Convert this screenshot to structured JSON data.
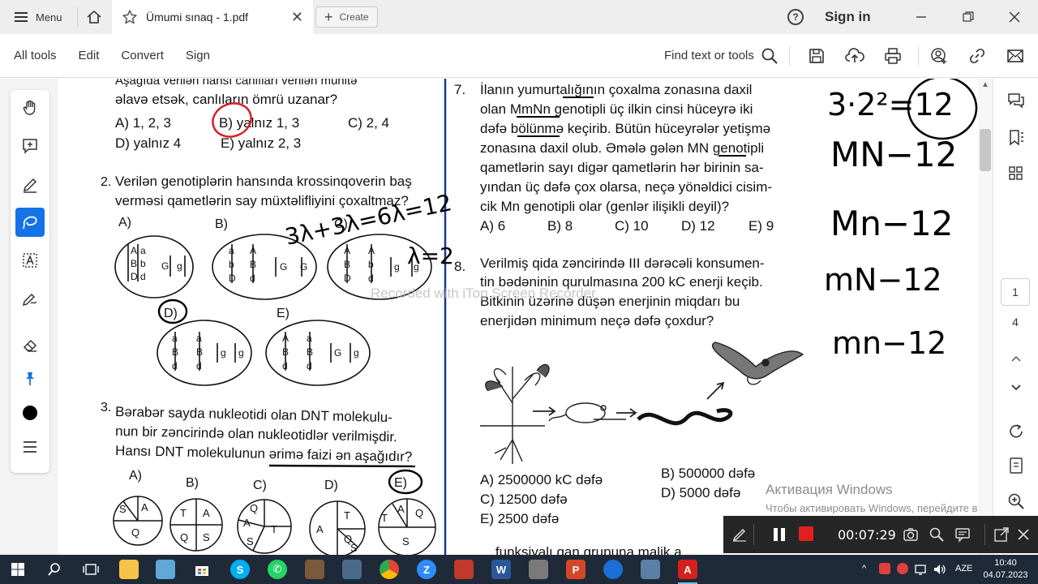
{
  "titlebar": {
    "menu_label": "Menu",
    "tab_title": "Ümumi sınaq - 1.pdf",
    "tab_close": "✕",
    "create_label": "Create",
    "help_symbol": "?",
    "signin_label": "Sign in"
  },
  "toolbar": {
    "items": [
      "All tools",
      "Edit",
      "Convert",
      "Sign"
    ],
    "find_label": "Find text or tools"
  },
  "page_nav": {
    "current": "1",
    "total": "4"
  },
  "watermark": "Recorded with iTop Screen Recorder",
  "activation": {
    "title": "Активация Windows",
    "text": "Чтобы активировать Windows, перейдите в раздел \"Параметры\"."
  },
  "recorder": {
    "time": "00:07:29"
  },
  "taskbar": {
    "lang": "AZE",
    "time": "10:40",
    "date": "04.07.2023",
    "running_apps": [
      "adobe-acrobat"
    ]
  },
  "document": {
    "q1": {
      "stem": [
        "Aşağıda verilən hansı canlıları verilən mühitə",
        "əlavə etsək, canlıların ömrü uzanar?"
      ],
      "options": [
        "A) 1, 2, 3",
        "B) yalnız 1, 3",
        "C) 2, 4",
        "D) yalnız 4",
        "E) yalnız 2, 3"
      ]
    },
    "q2": {
      "number": "2.",
      "stem": [
        "Verilən genotiplərin hansında krossinqoverin baş",
        "verməsi qametlərin say müxtəlifliyini çoxaltmaz?"
      ],
      "options": [
        "A)",
        "B)",
        "C)",
        "D)",
        "E)"
      ]
    },
    "q3": {
      "number": "3.",
      "stem": [
        "Bərabər sayda nukleotidi olan DNT molekulu-",
        "nun bir zəncirində olan nukleotidlər verilmişdir.",
        "Hansı DNT molekulunun ərimə faizi ən aşağıdır?"
      ],
      "options": [
        "A)",
        "B)",
        "C)",
        "D)",
        "E)"
      ]
    },
    "q7": {
      "number": "7.",
      "stem": [
        "İlanın yumurtalığının çoxalma zonasına daxil",
        "olan MmNn genotipli üç ilkin cinsi hüceyrə iki",
        "dəfə bölünmə keçirib. Bütün hüceyrələr yetişmə",
        "zonasına daxil olub. Əmələ gələn MN genotipli",
        "qametlərin sayı digər qametlərin hər birinin sa-",
        "yından üç dəfə çox olarsa, neçə yönəldici cisim-",
        "cik Mn genotipli olar (genlər ilişikli deyil)?"
      ],
      "options": [
        "A) 6",
        "B) 8",
        "C) 10",
        "D) 12",
        "E) 9"
      ]
    },
    "q8": {
      "number": "8.",
      "stem": [
        "Verilmiş qida zəncirində III dərəcəli konsumen-",
        "tin bədəninin qurulmasına 200 kC enerji keçib.",
        "Bitkinin üzərinə düşən enerjinin miqdarı bu",
        "enerjidən minimum neçə dəfə çoxdur?"
      ],
      "options": [
        "A) 2500000 kC dəfə",
        "B) 500000 dəfə",
        "C) 12500 dəfə",
        "D) 5000 dəfə",
        "E) 2500 dəfə"
      ]
    },
    "bottom_cut": "... funksiyalı qan qrupuna malik a",
    "handwriting": [
      "3·2²=12",
      "MN−12",
      "Mn−12",
      "mN−12",
      "mn−12",
      "3λ+3λ=6λ=12",
      "λ=2"
    ]
  }
}
